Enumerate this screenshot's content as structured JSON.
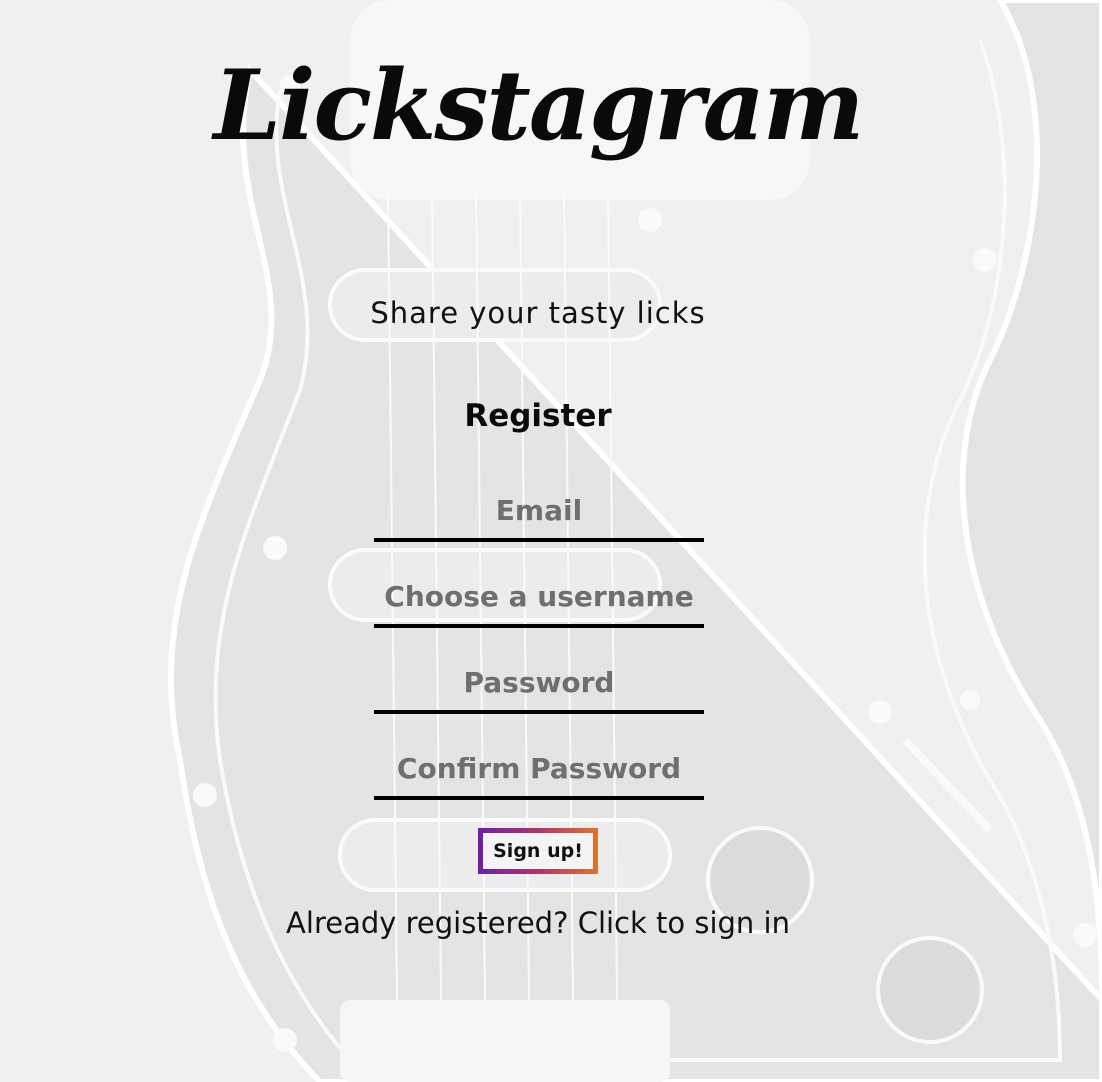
{
  "app": {
    "logo": "Lickstagram",
    "tagline": "Share your tasty licks"
  },
  "form": {
    "heading": "Register",
    "email": {
      "placeholder": "Email",
      "value": ""
    },
    "username": {
      "placeholder": "Choose a username",
      "value": ""
    },
    "password": {
      "placeholder": "Password",
      "value": ""
    },
    "confirm_password": {
      "placeholder": "Confirm Password",
      "value": ""
    },
    "submit_label": "Sign up!",
    "signin_link": "Already registered? Click to sign in"
  },
  "colors": {
    "button_gradient": [
      "#6a1fa8",
      "#b3326e",
      "#e0742a"
    ],
    "text": "#111111",
    "placeholder": "#6f6f6f"
  }
}
